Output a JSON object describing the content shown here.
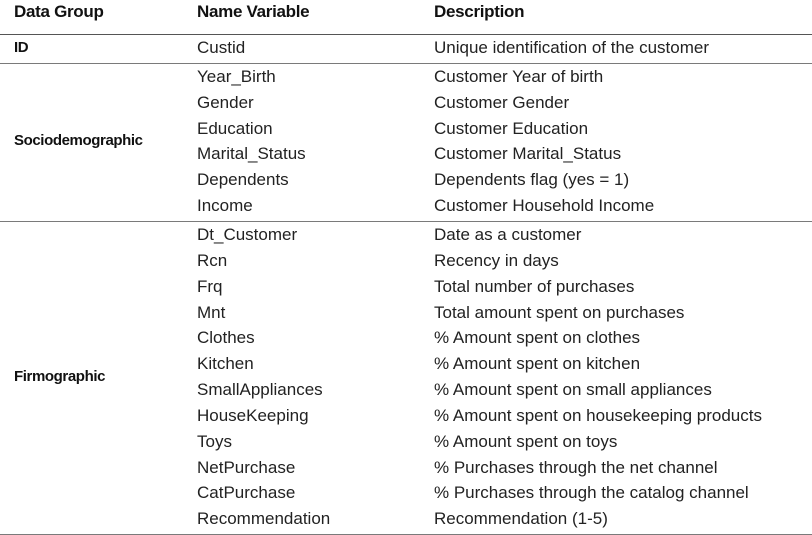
{
  "headers": {
    "data_group": "Data Group",
    "name_variable": "Name Variable",
    "description": "Description"
  },
  "groups": [
    {
      "label": "ID",
      "rows": [
        {
          "name": "Custid",
          "description": "Unique identification of the customer"
        }
      ]
    },
    {
      "label": "Sociodemographic",
      "rows": [
        {
          "name": "Year_Birth",
          "description": "Customer Year of birth"
        },
        {
          "name": "Gender",
          "description": "Customer Gender"
        },
        {
          "name": "Education",
          "description": "Customer Education"
        },
        {
          "name": "Marital_Status",
          "description": "Customer Marital_Status"
        },
        {
          "name": "Dependents",
          "description": "Dependents flag (yes = 1)"
        },
        {
          "name": "Income",
          "description": "Customer Household Income"
        }
      ]
    },
    {
      "label": "Firmographic",
      "rows": [
        {
          "name": "Dt_Customer",
          "description": "Date as a customer"
        },
        {
          "name": "Rcn",
          "description": "Recency in days"
        },
        {
          "name": "Frq",
          "description": "Total number of purchases"
        },
        {
          "name": "Mnt",
          "description": "Total amount spent on purchases"
        },
        {
          "name": "Clothes",
          "description": "% Amount spent on clothes"
        },
        {
          "name": "Kitchen",
          "description": "% Amount spent on kitchen"
        },
        {
          "name": "SmallAppliances",
          "description": "% Amount spent on small appliances"
        },
        {
          "name": "HouseKeeping",
          "description": "% Amount spent on housekeeping products"
        },
        {
          "name": "Toys",
          "description": "% Amount spent on toys"
        },
        {
          "name": "NetPurchase",
          "description": "% Purchases through the net channel"
        },
        {
          "name": "CatPurchase",
          "description": "% Purchases through the catalog channel"
        },
        {
          "name": "Recommendation",
          "description": "Recommendation (1-5)"
        }
      ]
    }
  ]
}
